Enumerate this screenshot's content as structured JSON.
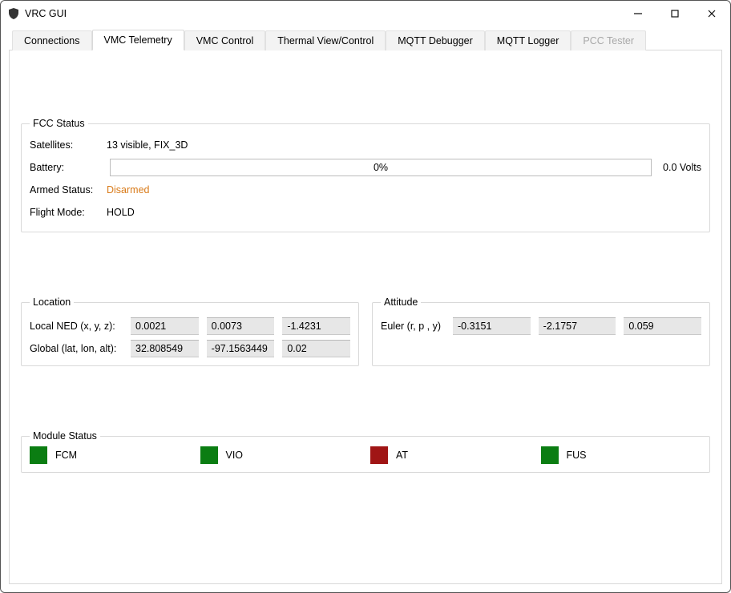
{
  "window": {
    "title": "VRC GUI"
  },
  "tabs": [
    {
      "label": "Connections",
      "active": false,
      "disabled": false
    },
    {
      "label": "VMC Telemetry",
      "active": true,
      "disabled": false
    },
    {
      "label": "VMC Control",
      "active": false,
      "disabled": false
    },
    {
      "label": "Thermal View/Control",
      "active": false,
      "disabled": false
    },
    {
      "label": "MQTT Debugger",
      "active": false,
      "disabled": false
    },
    {
      "label": "MQTT Logger",
      "active": false,
      "disabled": false
    },
    {
      "label": "PCC Tester",
      "active": false,
      "disabled": true
    }
  ],
  "fcc": {
    "legend": "FCC Status",
    "satellites_label": "Satellites:",
    "satellites_value": "13 visible, FIX_3D",
    "battery_label": "Battery:",
    "battery_pct": "0%",
    "battery_volts": "0.0 Volts",
    "armed_label": "Armed Status:",
    "armed_value": "Disarmed",
    "flightmode_label": "Flight Mode:",
    "flightmode_value": "HOLD"
  },
  "location": {
    "legend": "Location",
    "local_label": "Local NED (x, y, z):",
    "local_x": "0.0021",
    "local_y": "0.0073",
    "local_z": "-1.4231",
    "global_label": "Global (lat, lon, alt):",
    "global_lat": "32.808549",
    "global_lon": "-97.1563449",
    "global_alt": "0.02"
  },
  "attitude": {
    "legend": "Attitude",
    "euler_label": "Euler (r, p , y)",
    "roll": "-0.3151",
    "pitch": "-2.1757",
    "yaw": "0.059"
  },
  "modules": {
    "legend": "Module Status",
    "items": [
      {
        "name": "FCM",
        "color": "green"
      },
      {
        "name": "VIO",
        "color": "green"
      },
      {
        "name": "AT",
        "color": "red"
      },
      {
        "name": "FUS",
        "color": "green"
      }
    ]
  }
}
